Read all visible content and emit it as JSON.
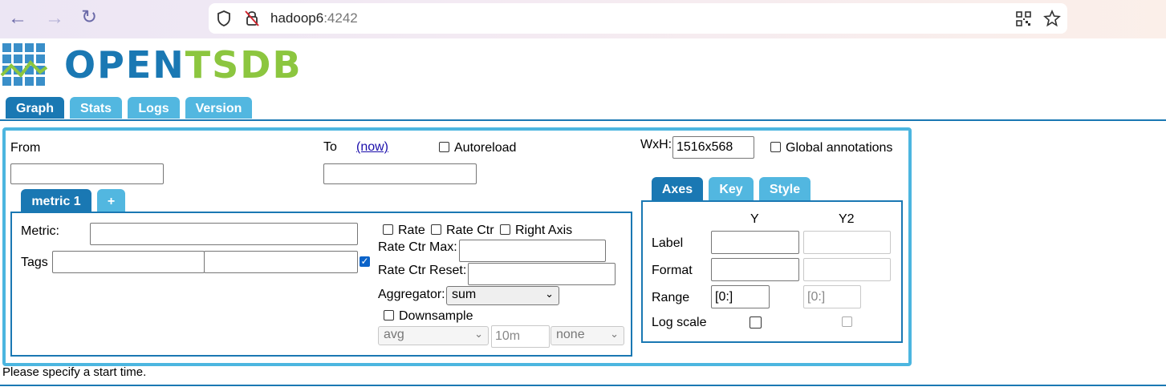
{
  "browser": {
    "back_icon": "back-arrow-icon",
    "forward_icon": "forward-arrow-icon",
    "reload_icon": "reload-icon",
    "url_host": "hadoop6",
    "url_port": ":4242"
  },
  "logo": {
    "text_open": "OPEN",
    "text_tsdb": "TSDB"
  },
  "nav_tabs": [
    {
      "label": "Graph"
    },
    {
      "label": "Stats"
    },
    {
      "label": "Logs"
    },
    {
      "label": "Version"
    }
  ],
  "form": {
    "from_label": "From",
    "to_label": "To",
    "now_link": "(now)",
    "autoreload_label": "Autoreload",
    "wxh_label": "WxH:",
    "wxh_value": "1516x568",
    "global_annotations_label": "Global annotations",
    "from_value": "",
    "to_value": ""
  },
  "metric_tabs": [
    {
      "label": "metric 1"
    },
    {
      "label": "+"
    }
  ],
  "metric": {
    "metric_label": "Metric:",
    "tags_label": "Tags",
    "rate_label": "Rate",
    "rate_ctr_label": "Rate Ctr",
    "right_axis_label": "Right Axis",
    "rate_ctr_max_label": "Rate Ctr Max:",
    "rate_ctr_reset_label": "Rate Ctr Reset:",
    "aggregator_label": "Aggregator:",
    "aggregator_value": "sum",
    "downsample_label": "Downsample",
    "downsample_func": "avg",
    "downsample_interval": "10m",
    "downsample_fill": "none"
  },
  "axes_tabs": [
    {
      "label": "Axes"
    },
    {
      "label": "Key"
    },
    {
      "label": "Style"
    }
  ],
  "axes": {
    "col_y": "Y",
    "col_y2": "Y2",
    "label_row": "Label",
    "format_row": "Format",
    "range_row": "Range",
    "logscale_row": "Log scale",
    "range_y": "[0:]",
    "range_y2": "[0:]"
  },
  "status": "Please specify a start time.",
  "colors": {
    "tab_active": "#1a78b3",
    "tab": "#52b7e0",
    "panel_border": "#4cb6e0",
    "logo_blue": "#1a78b3",
    "logo_green": "#8cc63f"
  }
}
